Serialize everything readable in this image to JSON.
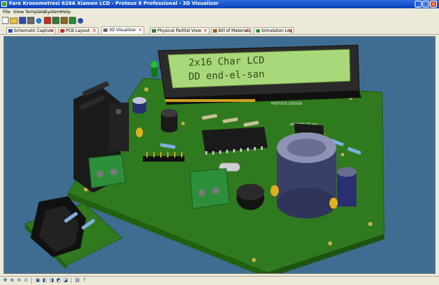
{
  "window": {
    "title": "Fare Kronometresi 628A Xiamen LCD - Proteus 8 Professional - 3D Visualizer",
    "minimize": "_",
    "maximize": "□",
    "close": "×"
  },
  "menu": [
    "File",
    "View",
    "Template",
    "System",
    "Help"
  ],
  "tabs": [
    {
      "label": "Schematic Capture",
      "close": "×",
      "icon_color": "#2a4fa8"
    },
    {
      "label": "PCB Layout",
      "close": "×",
      "icon_color": "#c4302b"
    },
    {
      "label": "3D Visualizer",
      "close": "×",
      "icon_color": "#6b6b6b"
    },
    {
      "label": "Physical Partlist View",
      "close": "×",
      "icon_color": "#3a7a3a"
    },
    {
      "label": "Bill of Materials",
      "close": "×",
      "icon_color": "#8a6a2a"
    },
    {
      "label": "Simulation Log",
      "close": "×",
      "icon_color": "#2a8a3a"
    }
  ],
  "lcd": {
    "line1": "2x16 Char LCD",
    "line2": "DD end-el-san",
    "silk1": "PROTEUS DESIGN",
    "silk2": "ANSWER TO ALL"
  },
  "statusbar_icons": [
    "pan-icon",
    "zoom-in-icon",
    "zoom-out-icon",
    "zoom-fit-icon",
    "view-top-icon",
    "view-front-icon",
    "view-left-icon",
    "view-right-icon",
    "view-back-icon",
    "print-icon",
    "help-icon"
  ],
  "colors": {
    "titlebar": "#0a3fb8",
    "pcb_green": "#2f7a1e",
    "viewport_bg": "#3f6d92",
    "lcd_screen": "#a8d87a"
  }
}
